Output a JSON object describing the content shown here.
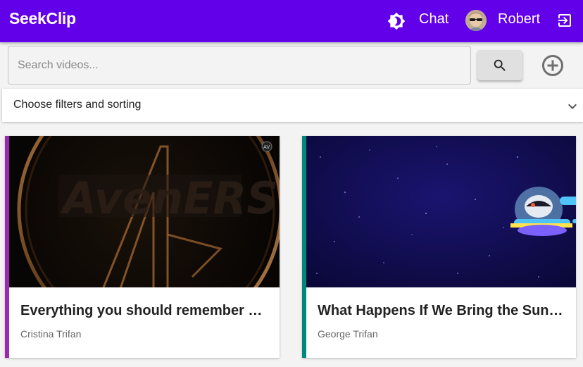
{
  "app": {
    "brand": "SeekClip"
  },
  "header": {
    "chat_label": "Chat",
    "user_name": "Robert"
  },
  "icons": {
    "theme": "brightness-icon",
    "logout": "logout-icon",
    "search": "search-icon",
    "add": "add-circle-icon",
    "chevron": "chevron-down-icon"
  },
  "search": {
    "placeholder": "Search videos...",
    "value": ""
  },
  "filters": {
    "label": "Choose filters and sorting"
  },
  "videos": [
    {
      "title": "Everything you should remember before watching Avengers: Endgame",
      "author": "Cristina Trifan",
      "accent": "#9c27b0",
      "thumbnail": "avengers-logo"
    },
    {
      "title": "What Happens If We Bring the Sun to Earth?",
      "author": "George Trifan",
      "accent": "#00897b",
      "thumbnail": "space-ufo"
    }
  ],
  "colors": {
    "primary": "#6200ea"
  }
}
